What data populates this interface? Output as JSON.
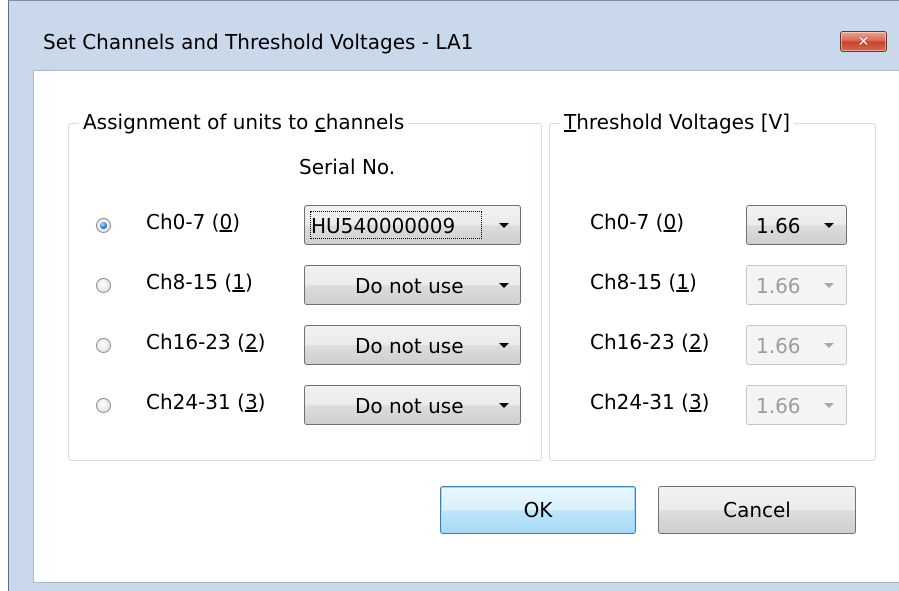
{
  "window": {
    "title": "Set Channels and Threshold Voltages - LA1",
    "close_glyph": "✕"
  },
  "assignment_group": {
    "title_pre": "Assignment of units to ",
    "title_accel": "c",
    "title_post": "hannels",
    "serial_header": "Serial No.",
    "rows": [
      {
        "name": "Ch0-7",
        "index": "0",
        "serial": "HU540000009",
        "selected": true
      },
      {
        "name": "Ch8-15",
        "index": "1",
        "serial": "Do not use",
        "selected": false
      },
      {
        "name": "Ch16-23",
        "index": "2",
        "serial": "Do not use",
        "selected": false
      },
      {
        "name": "Ch24-31",
        "index": "3",
        "serial": "Do not use",
        "selected": false
      }
    ]
  },
  "threshold_group": {
    "title_accel": "T",
    "title_post": "hreshold Voltages [V]",
    "rows": [
      {
        "name": "Ch0-7",
        "index": "0",
        "voltage": "1.66",
        "enabled": true
      },
      {
        "name": "Ch8-15",
        "index": "1",
        "voltage": "1.66",
        "enabled": false
      },
      {
        "name": "Ch16-23",
        "index": "2",
        "voltage": "1.66",
        "enabled": false
      },
      {
        "name": "Ch24-31",
        "index": "3",
        "voltage": "1.66",
        "enabled": false
      }
    ]
  },
  "buttons": {
    "ok_label": "OK",
    "cancel_label": "Cancel"
  },
  "colors": {
    "frame": "#c9d8ea",
    "close_button": "#c4412b",
    "default_button_border": "#3c7fb1"
  }
}
